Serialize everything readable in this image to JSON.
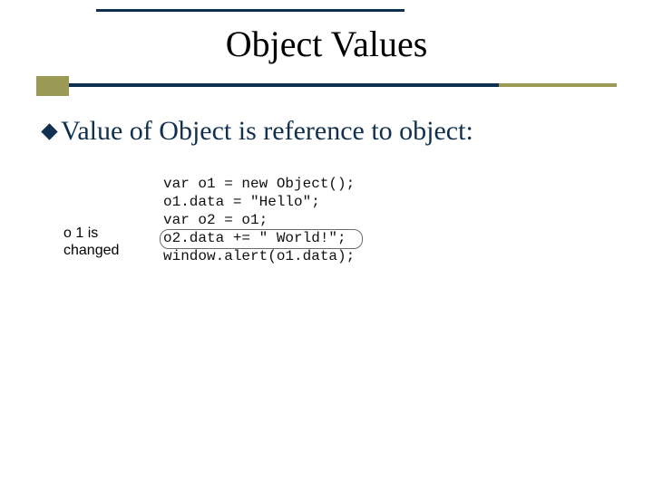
{
  "title": "Object Values",
  "bullet": "Value of Object is reference to object:",
  "annotation_line1": "o 1 is",
  "annotation_line2": "changed",
  "code": {
    "l1": "var o1 = new Object();",
    "l2": "o1.data = \"Hello\";",
    "l3": "var o2 = o1;",
    "l4": "o2.data += \" World!\";",
    "l5": "window.alert(o1.data);"
  }
}
